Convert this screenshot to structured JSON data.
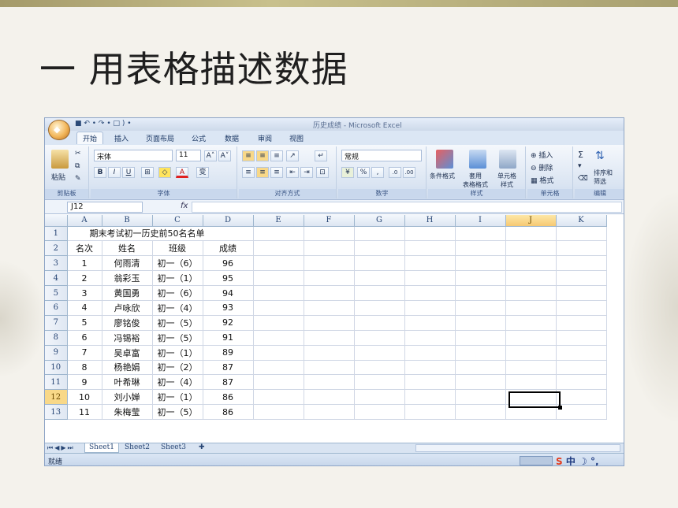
{
  "slide": {
    "title": "一 用表格描述数据"
  },
  "window": {
    "title": "历史成绩 - Microsoft Excel",
    "quick_access": "■ ↶ • ↷ • □ ) •"
  },
  "ribbon": {
    "tabs": [
      "开始",
      "插入",
      "页面布局",
      "公式",
      "数据",
      "审阅",
      "视图"
    ],
    "clipboard": {
      "label": "剪贴板",
      "paste": "粘贴"
    },
    "font": {
      "label": "字体",
      "name": "宋体",
      "size": "11",
      "bold": "B",
      "italic": "I",
      "underline": "U",
      "grow": "A˄",
      "shrink": "A˅",
      "color": "A",
      "phonetic": "变"
    },
    "alignment": {
      "label": "对齐方式"
    },
    "number": {
      "label": "数字",
      "format": "常规",
      "percent": "%",
      "comma": ",",
      "inc": ".0",
      "dec": ".00"
    },
    "styles": {
      "label": "样式",
      "cond": "条件格式",
      "table": "套用\n表格格式",
      "cell": "单元格\n样式"
    },
    "cells": {
      "label": "单元格",
      "insert": "插入",
      "delete": "删除",
      "format": "格式"
    },
    "editing": {
      "label": "编辑",
      "sum": "Σ",
      "sort": "排序和\n筛选"
    }
  },
  "formula_bar": {
    "name_box": "J12",
    "fx": "fx"
  },
  "columns": [
    "A",
    "B",
    "C",
    "D",
    "E",
    "F",
    "G",
    "H",
    "I",
    "J",
    "K"
  ],
  "sheet": {
    "title_row": "期末考试初一历史前50名名单",
    "headers": [
      "名次",
      "姓名",
      "班级",
      "成绩"
    ],
    "rows": [
      [
        "1",
        "何雨清",
        "初一（6）",
        "96"
      ],
      [
        "2",
        "翁彩玉",
        "初一（1）",
        "95"
      ],
      [
        "3",
        "黄国勇",
        "初一（6）",
        "94"
      ],
      [
        "4",
        "卢咏欣",
        "初一（4）",
        "93"
      ],
      [
        "5",
        "廖铭俊",
        "初一（5）",
        "92"
      ],
      [
        "6",
        "冯锡裕",
        "初一（5）",
        "91"
      ],
      [
        "7",
        "吴卓富",
        "初一（1）",
        "89"
      ],
      [
        "8",
        "杨艳娟",
        "初一（2）",
        "87"
      ],
      [
        "9",
        "叶希琳",
        "初一（4）",
        "87"
      ],
      [
        "10",
        "刘小婵",
        "初一（1）",
        "86"
      ],
      [
        "11",
        "朱梅莹",
        "初一（5）",
        "86"
      ]
    ]
  },
  "sheet_tabs": [
    "Sheet1",
    "Sheet2",
    "Sheet3"
  ],
  "status": {
    "text": "就绪",
    "ime": "中"
  }
}
